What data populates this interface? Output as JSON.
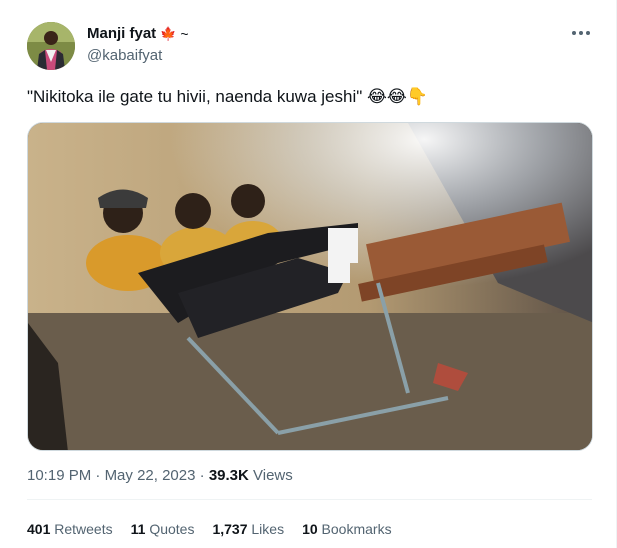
{
  "user": {
    "display_name": "Manji fyat",
    "flag": "🍁",
    "suffix": "~",
    "handle": "@kabaifyat"
  },
  "tweet": {
    "text": "\"Nikitoka ile gate tu hivii, naenda kuwa jeshi\" 😂😂👇",
    "time": "10:19 PM",
    "date": "May 22, 2023",
    "views_count": "39.3K",
    "views_label": "Views"
  },
  "stats": [
    {
      "num": "401",
      "label": "Retweets"
    },
    {
      "num": "11",
      "label": "Quotes"
    },
    {
      "num": "1,737",
      "label": "Likes"
    },
    {
      "num": "10",
      "label": "Bookmarks"
    }
  ],
  "icons": {
    "more": "more-horizontal-icon",
    "flag": "maple-leaf-icon"
  },
  "colors": {
    "text_primary": "#0f1419",
    "text_secondary": "#536471",
    "border": "#eff3f4"
  }
}
